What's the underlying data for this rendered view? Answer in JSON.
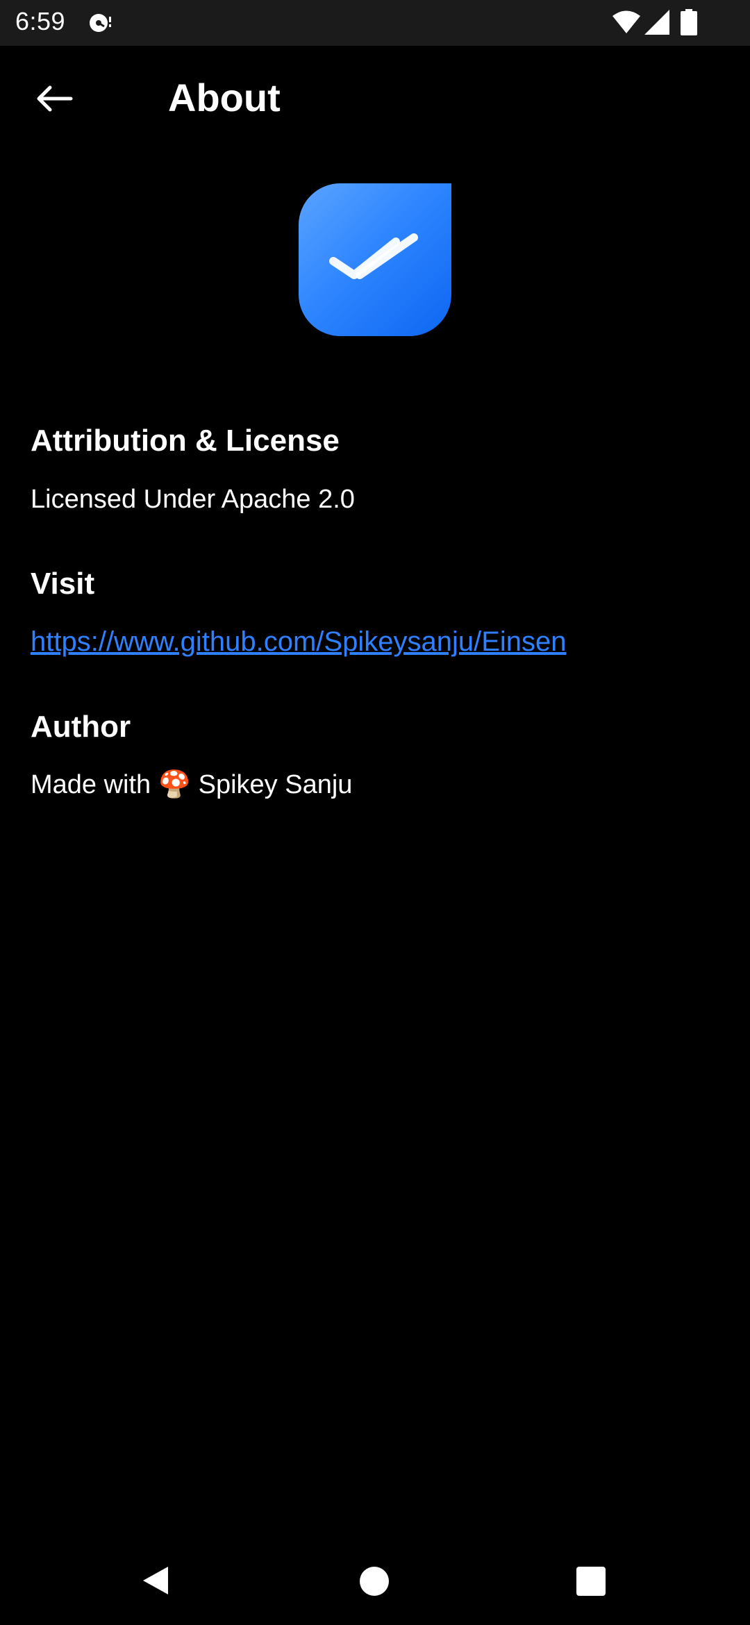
{
  "status_bar": {
    "time": "6:59",
    "icons": [
      "notification-icon",
      "wifi-icon",
      "signal-icon",
      "battery-icon"
    ]
  },
  "app_bar": {
    "back_icon": "arrow-left-icon",
    "title": "About"
  },
  "app_icon": {
    "name": "double-check-icon",
    "gradient_from": "#5ba4ff",
    "gradient_to": "#0d66f2"
  },
  "sections": {
    "license": {
      "heading": "Attribution & License",
      "text": "Licensed Under Apache 2.0"
    },
    "visit": {
      "heading": "Visit",
      "link": "https://www.github.com/Spikeysanju/Einsen",
      "link_color": "#2f80ff"
    },
    "author": {
      "heading": "Author",
      "text": "Made with 🍄 Spikey Sanju"
    }
  },
  "nav_bar": {
    "buttons": [
      "nav-back-icon",
      "nav-home-icon",
      "nav-recents-icon"
    ]
  }
}
